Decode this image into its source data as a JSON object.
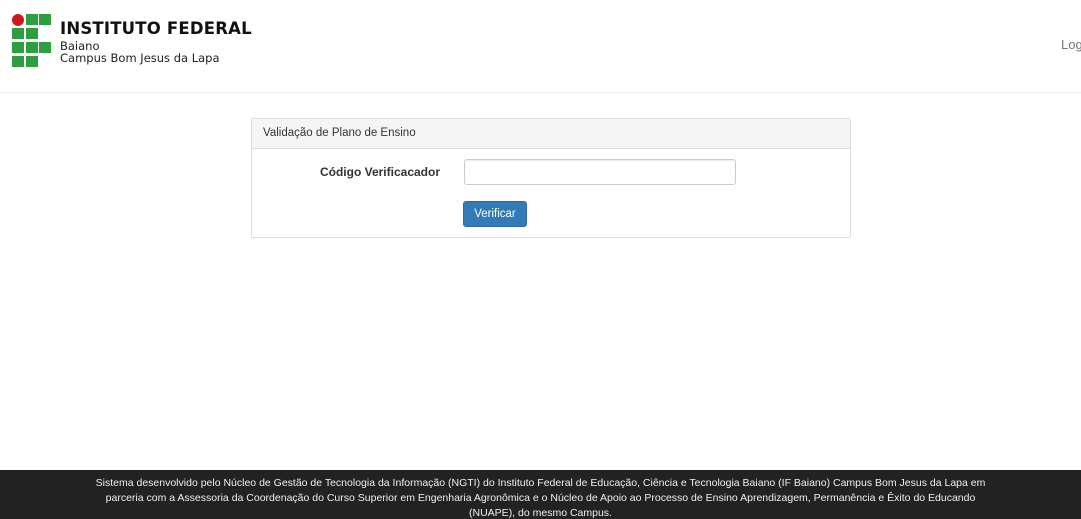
{
  "header": {
    "logo": {
      "title": "INSTITUTO FEDERAL",
      "subtitle": "Baiano",
      "campus": "Campus Bom Jesus da Lapa",
      "colors": {
        "green": "#2f9e41",
        "red": "#cd191e"
      },
      "icon": "if-logo-grid-icon"
    },
    "login_label": "Login"
  },
  "panel": {
    "heading": "Validação de Plano de Ensino",
    "field_label": "Código Verificacador",
    "field_value": "",
    "field_placeholder": "",
    "button_label": "Verificar",
    "button_color": "#337ab7"
  },
  "footer": {
    "text": "Sistema desenvolvido pelo Núcleo de Gestão de Tecnologia da Informação (NGTI) do Instituto Federal de Educação, Ciência e Tecnologia Baiano (IF Baiano) Campus Bom Jesus da Lapa em parceria com a Assessoria da Coordenação do Curso Superior em Engenharia Agronômica e o Núcleo de Apoio ao Processo de Ensino Aprendizagem, Permanência e Êxito do Educando (NUAPE), do mesmo Campus."
  }
}
